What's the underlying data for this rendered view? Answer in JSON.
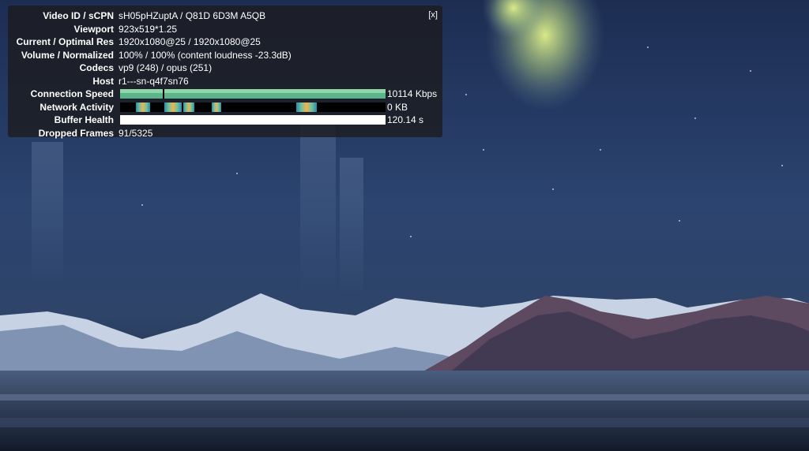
{
  "overlay": {
    "close_label": "[x]",
    "rows": [
      {
        "label": "Video ID / sCPN",
        "value": "sH05pHZuptA / Q81D 6D3M A5QB"
      },
      {
        "label": "Viewport",
        "value": "923x519*1.25"
      },
      {
        "label": "Current / Optimal Res",
        "value": "1920x1080@25 / 1920x1080@25"
      },
      {
        "label": "Volume / Normalized",
        "value": "100% / 100% (content loudness -23.3dB)"
      },
      {
        "label": "Codecs",
        "value": "vp9 (248) / opus (251)"
      },
      {
        "label": "Host",
        "value": "r1---sn-q4f7sn76"
      }
    ],
    "connection_speed": {
      "label": "Connection Speed",
      "value": "10114 Kbps",
      "fill_fraction": 1.0
    },
    "network_activity": {
      "label": "Network Activity",
      "value": "0 KB"
    },
    "buffer_health": {
      "label": "Buffer Health",
      "value": "120.14 s",
      "fill_fraction": 1.0
    },
    "dropped_frames": {
      "label": "Dropped Frames",
      "value": "91/5325"
    }
  },
  "colors": {
    "overlay_bg": "#1c1c20",
    "connection_bar": "#5ab58a",
    "network_spike": "#f4b24a",
    "buffer_bar": "#ffffff"
  }
}
